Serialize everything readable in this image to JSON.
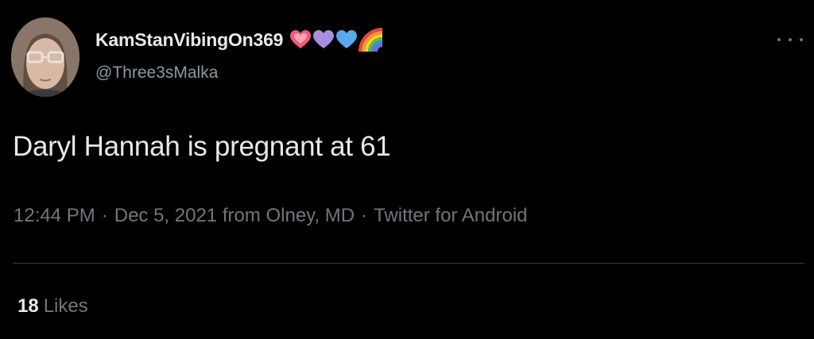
{
  "author": {
    "display_name": "KamStanVibingOn369",
    "handle": "@Three3sMalka",
    "name_emojis": [
      "sparkling-heart-icon",
      "purple-heart-icon",
      "blue-heart-icon",
      "rainbow-icon"
    ]
  },
  "tweet": {
    "text": "Daryl Hannah is pregnant at 61",
    "time": "12:44 PM",
    "separator_1": "·",
    "date_location": "Dec 5, 2021 from Olney, MD",
    "separator_2": "·",
    "source": "Twitter for Android"
  },
  "stats": {
    "likes_count": "18",
    "likes_label": "Likes"
  },
  "colors": {
    "background": "#000000",
    "primary_text": "#e7e9ea",
    "secondary_text": "#71767b",
    "divider": "#3a3d40"
  }
}
